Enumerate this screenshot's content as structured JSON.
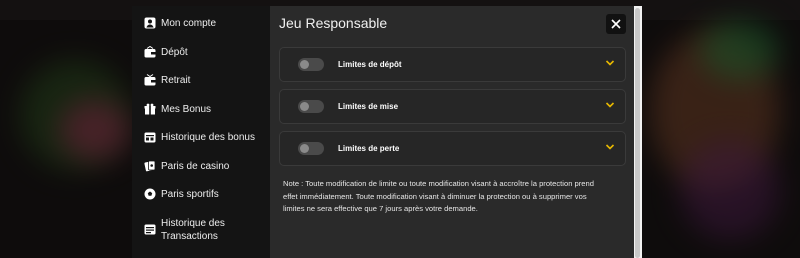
{
  "sidebar": {
    "items": [
      {
        "label": "Mon compte",
        "icon": "user-icon"
      },
      {
        "label": "Dépôt",
        "icon": "wallet-deposit-icon"
      },
      {
        "label": "Retrait",
        "icon": "wallet-withdraw-icon"
      },
      {
        "label": "Mes Bonus",
        "icon": "gift-icon"
      },
      {
        "label": "Historique des bonus",
        "icon": "bonus-history-icon"
      },
      {
        "label": "Paris de casino",
        "icon": "cards-icon"
      },
      {
        "label": "Paris sportifs",
        "icon": "soccer-ball-icon"
      },
      {
        "label": "Historique des Transactions",
        "icon": "transactions-icon"
      }
    ]
  },
  "main": {
    "title": "Jeu Responsable",
    "limits": [
      {
        "label": "Limites de dépôt",
        "enabled": false
      },
      {
        "label": "Limites de mise",
        "enabled": false
      },
      {
        "label": "Limites de perte",
        "enabled": false
      }
    ],
    "note": "Note : Toute modification de limite ou toute modification visant à accroître la protection prend effet immédiatement. Toute modification visant à diminuer la protection ou à supprimer vos limites ne sera effective que 7 jours après votre demande."
  },
  "colors": {
    "accent": "#e8b800",
    "sidebar_bg": "#141414",
    "panel_bg": "#2a2a2a"
  }
}
